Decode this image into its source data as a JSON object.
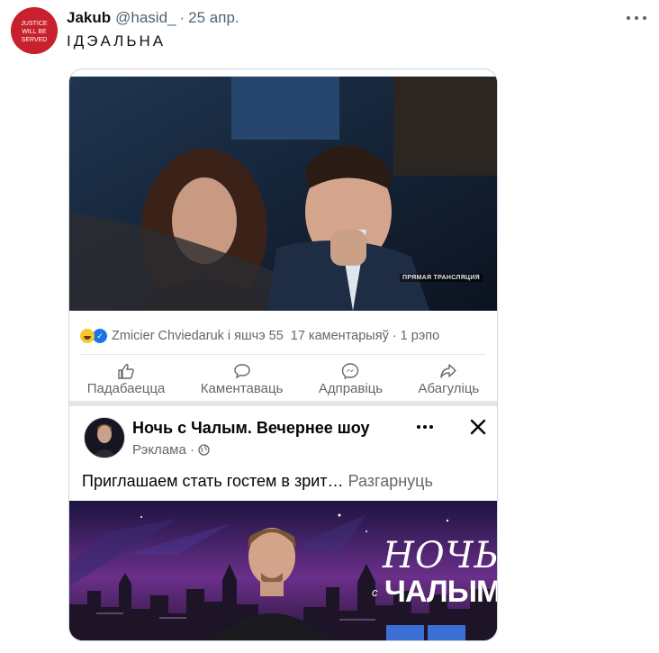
{
  "tweet": {
    "author_name": "Jakub",
    "author_handle": "@hasid_",
    "dot": "·",
    "date": "25 апр.",
    "text": "ІДЭАЛЬНА",
    "avatar_text": [
      "JUSTICE",
      "WILL BE",
      "SERVED"
    ]
  },
  "fb_post": {
    "live_tag": "ПРЯМАЯ ТРАНСЛЯЦИЯ",
    "reactors": "Zmicier Chviedaruk і яшчэ 55",
    "comments": "17 каментарыяў",
    "dot": "·",
    "shares": "1 рэпо",
    "actions": [
      {
        "label": "Падабаецца",
        "icon": "like-icon"
      },
      {
        "label": "Каментаваць",
        "icon": "comment-icon"
      },
      {
        "label": "Адправіць",
        "icon": "messenger-icon"
      },
      {
        "label": "Абагуліць",
        "icon": "share-icon"
      }
    ]
  },
  "ad": {
    "title": "Ночь с Чалым. Вечернее шоу",
    "sponsored": "Рэклама ·",
    "text": "Приглашаем стать гостем в зрит…",
    "expand": "Разгарнуць",
    "logo_top": "НОЧЬ",
    "logo_mid": "с",
    "logo_bottom": "ЧАЛЫМ"
  },
  "colors": {
    "fb_grey": "#65676b",
    "twitter_grey": "#536471",
    "avatar_red": "#c8202c",
    "banner_purple": "#6a2f8a"
  }
}
